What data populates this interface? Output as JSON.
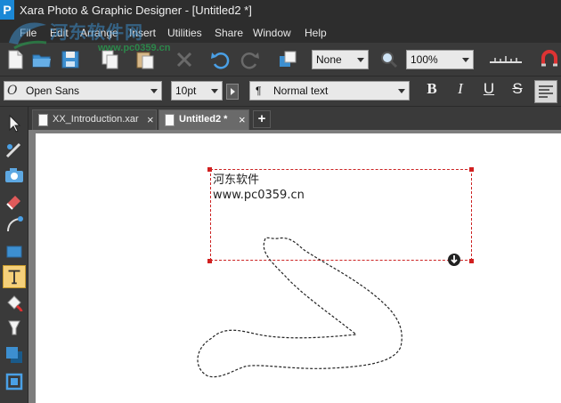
{
  "window": {
    "app_logo": "P",
    "title": "Xara Photo & Graphic Designer - [Untitled2 *]"
  },
  "menu": [
    "File",
    "Edit",
    "Arrange",
    "Insert",
    "Utilities",
    "Share",
    "Window",
    "Help"
  ],
  "watermark": {
    "text_cn": "河东软件网",
    "url": "www.pc0359.cn"
  },
  "toolbar": {
    "fill_select": "None",
    "zoom_select": "100%"
  },
  "text_toolbar": {
    "font_family": "Open Sans",
    "font_size": "10pt",
    "paragraph_style": "Normal text",
    "paragraph_icon": "¶",
    "bold_label": "B",
    "italic_label": "I",
    "underline_label": "U",
    "strike_label": "S"
  },
  "tabs": [
    {
      "label": "XX_Introduction.xar",
      "active": false
    },
    {
      "label": "Untitled2 *",
      "active": true
    }
  ],
  "new_tab_label": "+",
  "close_glyph": "×",
  "canvas": {
    "text_lines": [
      "河东软件",
      "www.pc0359.cn"
    ]
  },
  "colors": {
    "chrome": "#3a3a3a",
    "titlebar": "#2d2d2d",
    "accent": "#1b88d6",
    "selection": "#cc2222",
    "active_tool": "#f5d07a"
  }
}
